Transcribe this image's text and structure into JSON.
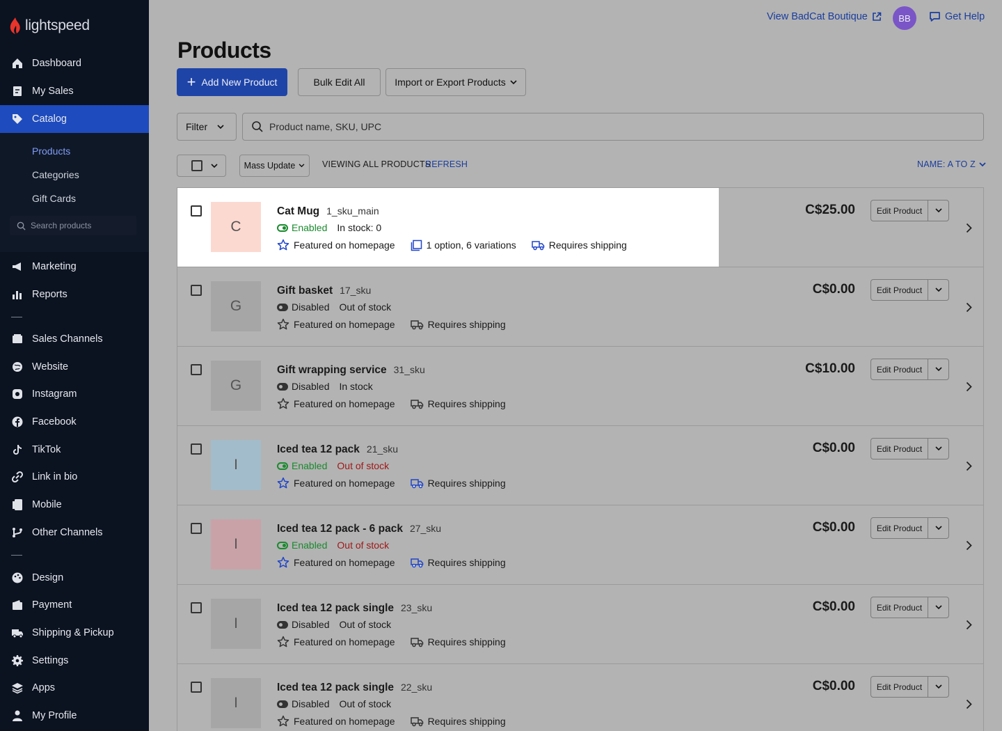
{
  "brand": {
    "name": "lightspeed",
    "accent": "#e8342a"
  },
  "sidebar": {
    "items": [
      {
        "label": "Dashboard",
        "icon": "home-icon"
      },
      {
        "label": "My Sales",
        "icon": "receipt-icon"
      },
      {
        "label": "Catalog",
        "icon": "tag-icon"
      },
      {
        "label": "Marketing",
        "icon": "megaphone-icon"
      },
      {
        "label": "Reports",
        "icon": "bar-chart-icon"
      },
      {
        "label": "Sales Channels",
        "icon": "channels-icon"
      },
      {
        "label": "Website",
        "icon": "globe-icon"
      },
      {
        "label": "Instagram",
        "icon": "instagram-icon"
      },
      {
        "label": "Facebook",
        "icon": "facebook-icon"
      },
      {
        "label": "TikTok",
        "icon": "tiktok-icon"
      },
      {
        "label": "Link in bio",
        "icon": "link-icon"
      },
      {
        "label": "Mobile",
        "icon": "mobile-icon"
      },
      {
        "label": "Other Channels",
        "icon": "branch-icon"
      },
      {
        "label": "Design",
        "icon": "palette-icon"
      },
      {
        "label": "Payment",
        "icon": "wallet-icon"
      },
      {
        "label": "Shipping & Pickup",
        "icon": "truck-icon"
      },
      {
        "label": "Settings",
        "icon": "gear-icon"
      },
      {
        "label": "Apps",
        "icon": "layers-icon"
      },
      {
        "label": "My Profile",
        "icon": "user-icon"
      }
    ],
    "catalog_sub": [
      "Products",
      "Categories",
      "Gift Cards"
    ],
    "search_placeholder": "Search products"
  },
  "topbar": {
    "store_link": "View BadCat Boutique",
    "avatar_initials": "BB",
    "help": "Get Help"
  },
  "page": {
    "title": "Products",
    "add_button": "Add New Product",
    "bulk_button": "Bulk Edit All",
    "import_button": "Import or Export Products",
    "filter": "Filter",
    "search_placeholder": "Product name, SKU, UPC",
    "mass_update": "Mass Update",
    "viewing": "VIEWING ALL PRODUCTS",
    "refresh": "REFRESH",
    "sort": "NAME: A TO Z"
  },
  "products": [
    {
      "initial": "C",
      "name": "Cat Mug",
      "sku": "1_sku_main",
      "status": "Enabled",
      "stock": "In stock: 0",
      "featured": "Featured on homepage",
      "options": "1 option, 6 variations",
      "shipping": "Requires shipping",
      "price": "C$25.00",
      "thumb_color": "#fcd9d0"
    },
    {
      "initial": "G",
      "name": "Gift basket",
      "sku": "17_sku",
      "status": "Disabled",
      "stock": "Out of stock",
      "featured": "Featured on homepage",
      "shipping": "Requires shipping",
      "price": "C$0.00",
      "thumb_color": "#a6a6a6"
    },
    {
      "initial": "G",
      "name": "Gift wrapping service",
      "sku": "31_sku",
      "status": "Disabled",
      "stock": "In stock",
      "featured": "Featured on homepage",
      "shipping": "Requires shipping",
      "price": "C$10.00",
      "thumb_color": "#a6a6a6"
    },
    {
      "initial": "I",
      "name": "Iced tea 12 pack",
      "sku": "21_sku",
      "status": "Enabled",
      "stock": "Out of stock",
      "featured": "Featured on homepage",
      "shipping": "Requires shipping",
      "price": "C$0.00",
      "thumb_color": "#a3bccb"
    },
    {
      "initial": "I",
      "name": "Iced tea 12 pack - 6 pack",
      "sku": "27_sku",
      "status": "Enabled",
      "stock": "Out of stock",
      "featured": "Featured on homepage",
      "shipping": "Requires shipping",
      "price": "C$0.00",
      "thumb_color": "#c9a2a8"
    },
    {
      "initial": "I",
      "name": "Iced tea 12 pack single",
      "sku": "23_sku",
      "status": "Disabled",
      "stock": "Out of stock",
      "featured": "Featured on homepage",
      "shipping": "Requires shipping",
      "price": "C$0.00",
      "thumb_color": "#a6a6a6"
    },
    {
      "initial": "I",
      "name": "Iced tea 12 pack single",
      "sku": "22_sku",
      "status": "Disabled",
      "stock": "Out of stock",
      "featured": "Featured on homepage",
      "shipping": "Requires shipping",
      "price": "C$0.00",
      "thumb_color": "#a6a6a6"
    }
  ],
  "edit_label": "Edit Product"
}
